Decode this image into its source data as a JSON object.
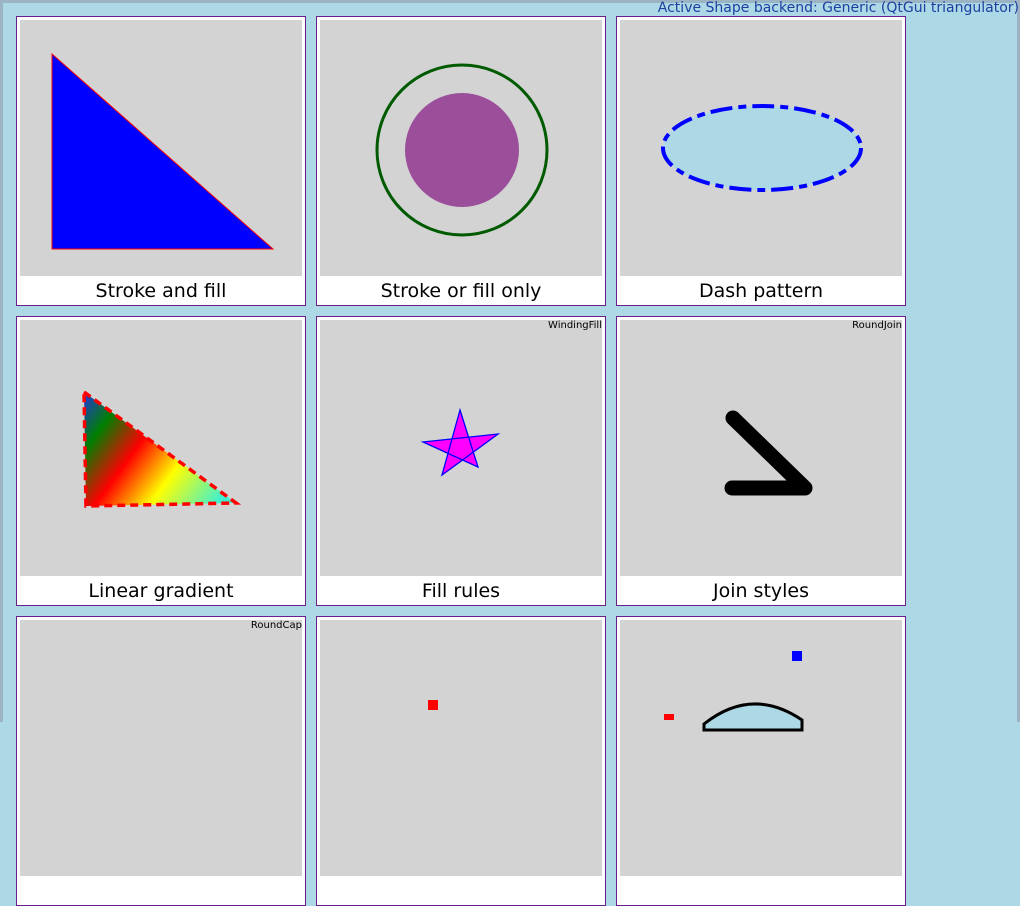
{
  "status_text": "Active Shape backend: Generic (QtGui triangulator)",
  "tiles": {
    "stroke_and_fill": {
      "caption": "Stroke and fill",
      "fill": "#0000ff",
      "stroke": "#ff0000"
    },
    "stroke_or_fill_only": {
      "caption": "Stroke or fill only",
      "ring_color": "#005a00",
      "disc_color": "#9b4f9b"
    },
    "dash_pattern": {
      "caption": "Dash pattern",
      "fill": "#add8e6",
      "stroke": "#0000ff"
    },
    "linear_gradient": {
      "caption": "Linear gradient",
      "stroke": "#ff0000"
    },
    "fill_rules": {
      "caption": "Fill rules",
      "tag": "WindingFill",
      "fill": "#ff00ff",
      "stroke": "#0000ff"
    },
    "join_styles": {
      "caption": "Join styles",
      "tag": "RoundJoin",
      "stroke": "#000000"
    },
    "cap_styles": {
      "tag": "RoundCap"
    }
  }
}
